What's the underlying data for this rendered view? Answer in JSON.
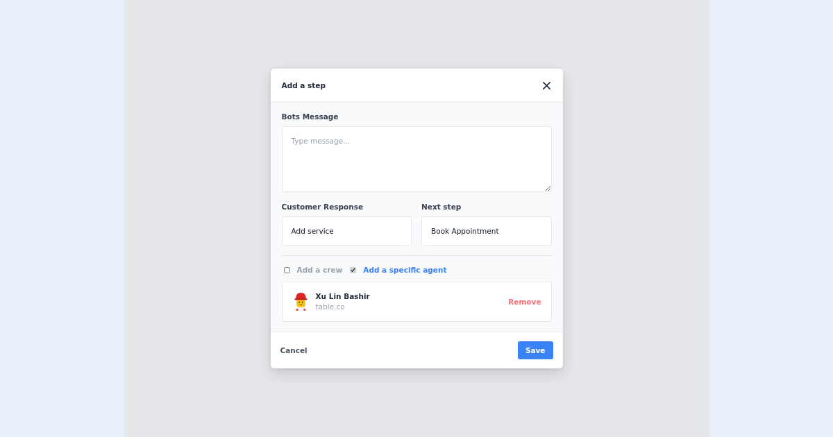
{
  "dialog": {
    "title": "Add a step",
    "fields": [
      {
        "kind": "textarea",
        "label": "Bots Message",
        "placeholder": "Type message..."
      },
      {
        "kind": "input",
        "label": "Customer Response",
        "value": "Add service"
      },
      {
        "kind": "input",
        "label": "Next step",
        "value": "Book Appointment"
      }
    ],
    "assign_options": [
      {
        "label": "Add a crew",
        "checked": false
      },
      {
        "label": "Add a specific agent",
        "checked": true
      }
    ],
    "agent": {
      "name": "Xu Lin Bashir",
      "company": "table.co",
      "action": "Remove"
    },
    "actions": [
      {
        "kind": "secondary",
        "label": "Cancel"
      },
      {
        "kind": "primary",
        "label": "Save"
      }
    ]
  }
}
